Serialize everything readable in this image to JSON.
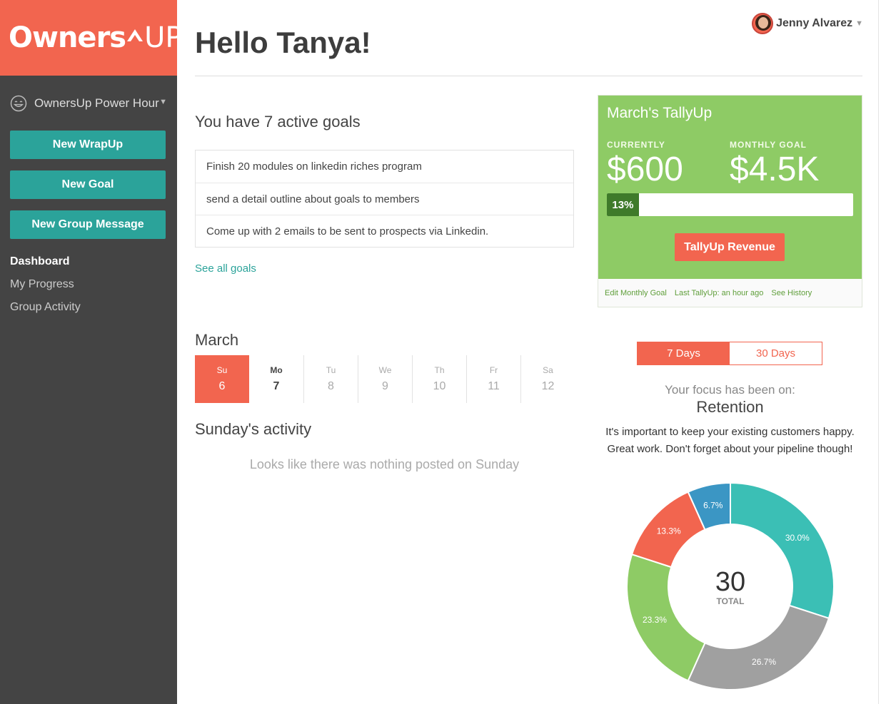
{
  "brand": {
    "name": "Owners",
    "suffix": "UP",
    "accent": "#f2654f",
    "teal": "#2ba39a",
    "green": "#8ecb65"
  },
  "sidebar": {
    "group": "OwnersUp Power Hour",
    "buttons": [
      "New WrapUp",
      "New Goal",
      "New Group Message"
    ],
    "nav": [
      "Dashboard",
      "My Progress",
      "Group Activity"
    ],
    "active_nav": "Dashboard"
  },
  "header": {
    "greeting": "Hello Tanya!",
    "user": "Jenny Alvarez"
  },
  "goals": {
    "title": "You have 7 active goals",
    "items": [
      "Finish 20 modules on linkedin riches program",
      "send a detail outline about goals to members",
      "Come up with 2 emails to be sent to prospects via Linkedin."
    ],
    "see_all": "See all goals"
  },
  "calendar": {
    "month": "March",
    "days": [
      {
        "name": "Su",
        "date": "6"
      },
      {
        "name": "Mo",
        "date": "7"
      },
      {
        "name": "Tu",
        "date": "8"
      },
      {
        "name": "We",
        "date": "9"
      },
      {
        "name": "Th",
        "date": "10"
      },
      {
        "name": "Fr",
        "date": "11"
      },
      {
        "name": "Sa",
        "date": "12"
      }
    ],
    "selected": "Su",
    "today": "Mo"
  },
  "activity": {
    "title": "Sunday's activity",
    "empty": "Looks like there was nothing posted on Sunday"
  },
  "tally": {
    "title": "March's TallyUp",
    "current_label": "CURRENTLY",
    "current_value": "$600",
    "goal_label": "MONTHLY GOAL",
    "goal_value": "$4.5K",
    "progress_label": "13%",
    "progress_fraction": 0.13,
    "button": "TallyUp Revenue",
    "edit_link": "Edit Monthly Goal",
    "last": "Last TallyUp: an hour ago",
    "history_link": "See History"
  },
  "focus": {
    "ranges": [
      "7 Days",
      "30 Days"
    ],
    "active_range": "7 Days",
    "label": "Your focus has been on:",
    "value": "Retention",
    "message_line1": "It's important to keep your existing customers happy.",
    "message_line2": "Great work. Don't forget about your pipeline though!"
  },
  "chart_data": {
    "type": "pie",
    "variant": "donut",
    "total": 30,
    "total_label": "TOTAL",
    "slices": [
      {
        "label": "30.0%",
        "value": 30.0,
        "color": "#3bbfb5"
      },
      {
        "label": "26.7%",
        "value": 26.7,
        "color": "#a0a0a0"
      },
      {
        "label": "23.3%",
        "value": 23.3,
        "color": "#8ecb65"
      },
      {
        "label": "13.3%",
        "value": 13.3,
        "color": "#f2654f"
      },
      {
        "label": "6.7%",
        "value": 6.7,
        "color": "#3b96c4"
      }
    ]
  }
}
